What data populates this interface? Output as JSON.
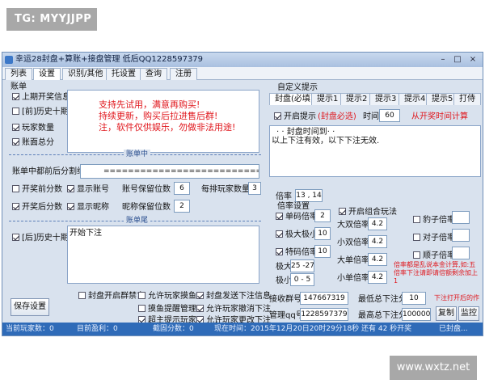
{
  "watermark_top": "TG: MYYJJPP",
  "watermark_bottom": "www.wxtz.net",
  "window": {
    "title": "幸运28封盘+算账+接盘管理 低后QQ1228597379",
    "minimize": "–",
    "maximize": "□",
    "close": "×"
  },
  "tabs": [
    "列表",
    "设置",
    "识别/其他",
    "托设置",
    "查询",
    "注册"
  ],
  "ledger": {
    "group_label": "账单",
    "upper_info": "上期开奖信息",
    "prev10": "[前]历史十期",
    "player_count": "玩家数量",
    "ledger_total": "账面总分",
    "notice_lines": [
      "支持先试用，满意再购买!",
      "持续更新，购买后拉进售后群!",
      "注，软件仅供娱乐，勿做非法用途!"
    ],
    "middle_sep": "账单中",
    "middle_split_label": "账单中都前后分割线",
    "middle_split_value": "===============================",
    "open_before": "开奖前分数",
    "show_account": "显示账号",
    "account_digits_label": "账号保留位数",
    "account_digits": "6",
    "per_row_label": "每排玩家数量",
    "per_row": "3",
    "open_after": "开奖后分数",
    "show_nickname": "显示昵称",
    "nick_digits_label": "昵称保留位数",
    "nick_digits": "2",
    "tail_sep": "账单尾",
    "after10": "[后]历史十期",
    "tail_text": "开始下注"
  },
  "custom_prompt": {
    "group_label": "自定义提示",
    "tabs": [
      "封盘(必填)",
      "提示1",
      "提示2",
      "提示3",
      "提示4",
      "提示5",
      "打侍"
    ],
    "enable_label": "开启提示",
    "enable_note": "(封盘必选)",
    "time_label": "时间",
    "time_value": "60",
    "time_note": "从开奖时间计算",
    "body_line1": "· · 封盘时间到· ·",
    "body_line2": "以上下注有效，以下下注无效."
  },
  "multiplier": {
    "label": "倍率",
    "value": "13 , 14",
    "settings_label": "倍率设置",
    "single_label": "单码倍率",
    "single_value": "2",
    "big_small_label": "极大极小",
    "big_small_value": "10",
    "special_label": "特码倍率",
    "special_value": "10",
    "max_label": "极大",
    "max_value": "25 -27",
    "min_label": "极小",
    "min_value": "0 - 5",
    "combo_label": "开启组合玩法",
    "combo": [
      {
        "label": "大双倍率",
        "value": "4.2"
      },
      {
        "label": "小双倍率",
        "value": "4.2"
      },
      {
        "label": "大单倍率",
        "value": "4.2"
      },
      {
        "label": "小单倍率",
        "value": "4.2"
      }
    ],
    "leopard_label": "豹子倍率",
    "pair_label": "对子倍率",
    "straight_label": "顺子倍率",
    "red_note": "倍率都是乱说本金计算,如:五倍率下注请即请倍额剩余加上 1"
  },
  "options": {
    "save": "保存设置",
    "seal_group_ban": "封盘开启群禁言",
    "allow_player_place": "允许玩家摸鱼",
    "seal_send_info": "封盘发送下注信息",
    "catch_remind": "摸鱼提醒管理",
    "allow_cancel": "允许玩家撤消下注",
    "super_remind": "超主提示玩家",
    "allow_modify": "允许玩家更改下注"
  },
  "accounts": {
    "receive_label": "接收群号",
    "receive_value": "147667319",
    "manage_label": "管理qq号",
    "manage_value": "1228597379",
    "min_bet_label": "最低总下注分",
    "min_bet_value": "10",
    "max_bet_label": "最高总下注分",
    "max_bet_value": "100000",
    "red_hint": "下注打开后的作",
    "copy_btn": "复制",
    "monitor_btn": "监控"
  },
  "status": {
    "players": "当前玩家数：0",
    "profit": "目前盈利：0",
    "seal_round": "截固分数：0",
    "time": "现在时间：2015年12月20日20时29分18秒",
    "remain": "还有 42 秒开奖",
    "state": "已封盘..."
  }
}
